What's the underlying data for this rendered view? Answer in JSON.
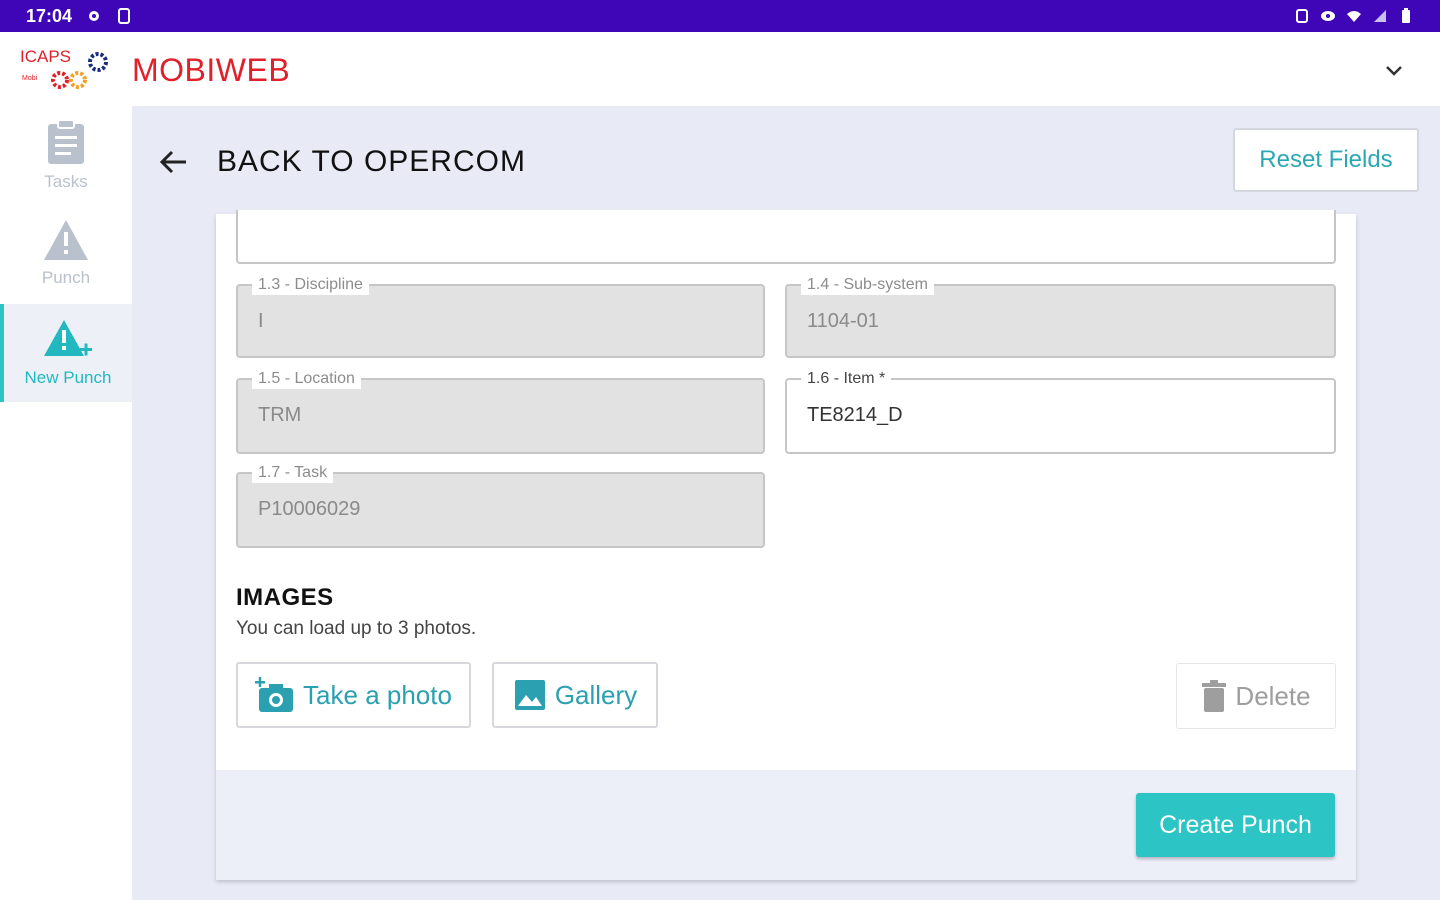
{
  "statusbar": {
    "time": "17:04"
  },
  "app": {
    "brand": "MOBIWEB",
    "logo_text": "ICAPS"
  },
  "sidebar": {
    "items": [
      {
        "label": "Tasks",
        "icon": "clipboard-icon",
        "active": false
      },
      {
        "label": "Punch",
        "icon": "warning-icon",
        "active": false
      },
      {
        "label": "New Punch",
        "icon": "warning-plus-icon",
        "active": true
      }
    ]
  },
  "header": {
    "back_label": "BACK TO OPERCOM",
    "reset_label": "Reset Fields"
  },
  "form": {
    "discipline": {
      "label": "1.3 - Discipline",
      "value": "I"
    },
    "subsystem": {
      "label": "1.4 - Sub-system",
      "value": "1104-01"
    },
    "location": {
      "label": "1.5 - Location",
      "value": "TRM"
    },
    "item": {
      "label": "1.6 - Item *",
      "value": "TE8214_D"
    },
    "task": {
      "label": "1.7 - Task",
      "value": "P10006029"
    }
  },
  "images": {
    "title": "IMAGES",
    "subtitle": "You can load up to 3 photos.",
    "take_photo_label": "Take a photo",
    "gallery_label": "Gallery",
    "delete_label": "Delete"
  },
  "actions": {
    "create_label": "Create Punch"
  },
  "colors": {
    "accent": "#2cc4c4",
    "statusbar": "#3f06b8",
    "brand": "#e0202a"
  }
}
